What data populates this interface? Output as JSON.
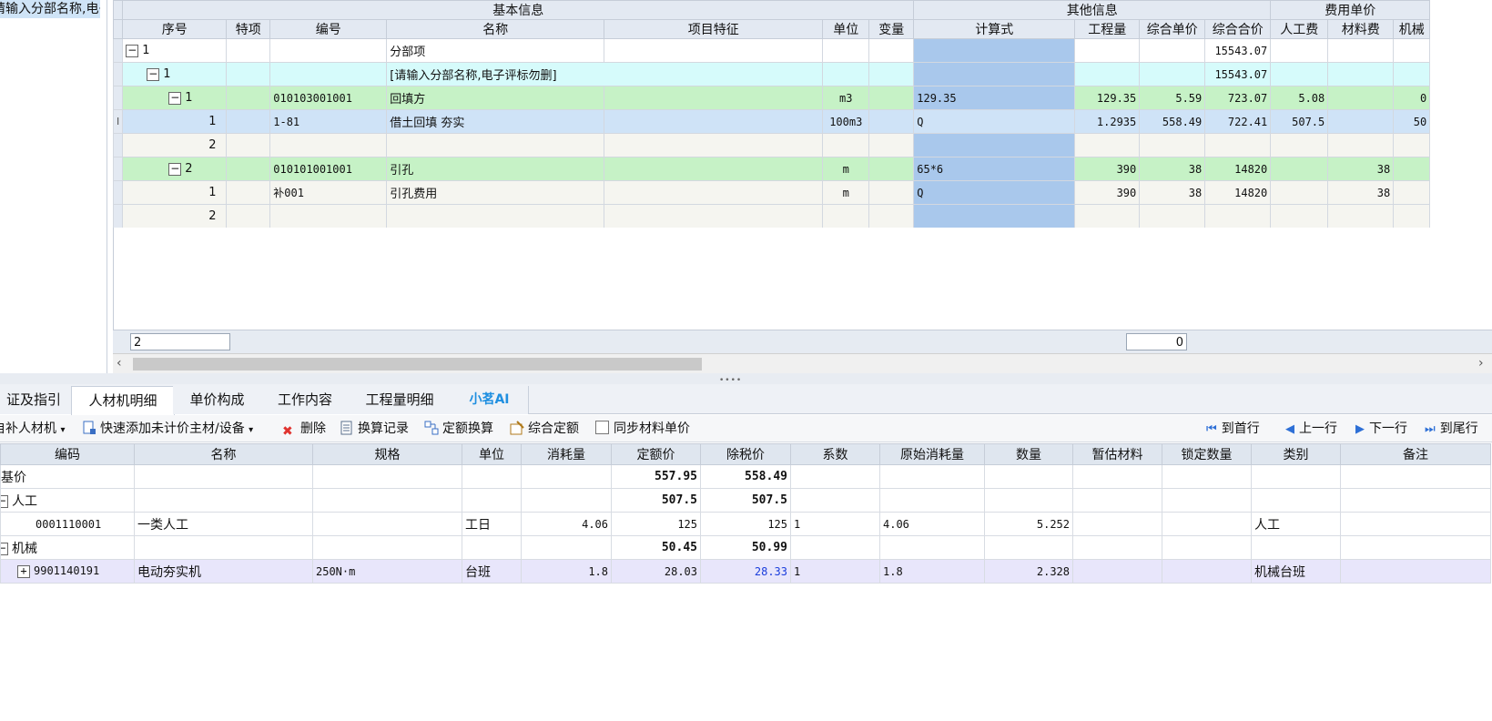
{
  "left_tree": {
    "selected_item": "请输入分部名称,电子评标勿删"
  },
  "top_grid": {
    "group_headers": {
      "basic": "基本信息",
      "other": "其他信息",
      "fee": "费用单价"
    },
    "columns": [
      "序号",
      "特项",
      "编号",
      "名称",
      "项目特征",
      "单位",
      "变量",
      "计算式",
      "工程量",
      "综合单价",
      "综合合价",
      "人工费",
      "材料费",
      "机械"
    ],
    "rows": [
      {
        "seq": "1",
        "code": "",
        "name": "分部项",
        "feature": "",
        "unit": "",
        "formula": "",
        "qty": "",
        "uprice": "",
        "total": "15543.07",
        "labor": "",
        "material": "",
        "machine": ""
      },
      {
        "seq": "1",
        "code": "",
        "name": "[请输入分部名称,电子评标勿删]",
        "feature": "",
        "unit": "",
        "formula": "",
        "qty": "",
        "uprice": "",
        "total": "15543.07",
        "labor": "",
        "material": "",
        "machine": ""
      },
      {
        "seq": "1",
        "code": "010103001001",
        "name": "回填方",
        "feature": "",
        "unit": "m3",
        "formula": "129.35",
        "qty": "129.35",
        "uprice": "5.59",
        "total": "723.07",
        "labor": "5.08",
        "material": "",
        "machine": "0"
      },
      {
        "seq": "1",
        "code": "1-81",
        "name": "借土回填 夯实",
        "feature": "",
        "unit": "100m3",
        "formula": "Q",
        "qty": "1.2935",
        "uprice": "558.49",
        "total": "722.41",
        "labor": "507.5",
        "material": "",
        "machine": "50"
      },
      {
        "seq": "2",
        "code": "",
        "name": "",
        "feature": "",
        "unit": "",
        "formula": "",
        "qty": "",
        "uprice": "",
        "total": "",
        "labor": "",
        "material": "",
        "machine": ""
      },
      {
        "seq": "2",
        "code": "010101001001",
        "name": "引孔",
        "feature": "",
        "unit": "m",
        "formula": "65*6",
        "qty": "390",
        "uprice": "38",
        "total": "14820",
        "labor": "",
        "material": "38",
        "machine": ""
      },
      {
        "seq": "1",
        "code": "补001",
        "name": "引孔费用",
        "feature": "",
        "unit": "m",
        "formula": "Q",
        "qty": "390",
        "uprice": "38",
        "total": "14820",
        "labor": "",
        "material": "38",
        "machine": ""
      },
      {
        "seq": "2",
        "code": "",
        "name": "",
        "feature": "",
        "unit": "",
        "formula": "",
        "qty": "",
        "uprice": "",
        "total": "",
        "labor": "",
        "material": "",
        "machine": ""
      }
    ],
    "footer": {
      "seq_input": "2",
      "qty_input": "0"
    }
  },
  "tabs": [
    {
      "label": "证及指引"
    },
    {
      "label": "人材机明细"
    },
    {
      "label": "单价构成"
    },
    {
      "label": "工作内容"
    },
    {
      "label": "工程量明细"
    },
    {
      "label": "小茗AI"
    }
  ],
  "toolbar": {
    "supplement": "自补人材机",
    "quick_add": "快速添加未计价主材/设备",
    "delete": "删除",
    "calc_record": "换算记录",
    "quota_convert": "定额换算",
    "composite_quota": "综合定额",
    "sync_price": "同步材料单价",
    "first": "到首行",
    "prev": "上一行",
    "next": "下一行",
    "last": "到尾行"
  },
  "bottom_grid": {
    "columns": [
      "编码",
      "名称",
      "规格",
      "单位",
      "消耗量",
      "定额价",
      "除税价",
      "系数",
      "原始消耗量",
      "数量",
      "暂估材料",
      "锁定数量",
      "类别",
      "备注"
    ],
    "rows": [
      {
        "code": "基价",
        "name": "",
        "spec": "",
        "unit": "",
        "consume": "",
        "quota": "557.95",
        "taxfree": "558.49",
        "coef": "",
        "orig": "",
        "qty": "",
        "category": ""
      },
      {
        "code": "人工",
        "name": "",
        "spec": "",
        "unit": "",
        "consume": "",
        "quota": "507.5",
        "taxfree": "507.5",
        "coef": "",
        "orig": "",
        "qty": "",
        "category": ""
      },
      {
        "code": "0001110001",
        "name": "一类人工",
        "spec": "",
        "unit": "工日",
        "consume": "4.06",
        "quota": "125",
        "taxfree": "125",
        "coef": "1",
        "orig": "4.06",
        "qty": "5.252",
        "category": "人工"
      },
      {
        "code": "机械",
        "name": "",
        "spec": "",
        "unit": "",
        "consume": "",
        "quota": "50.45",
        "taxfree": "50.99",
        "coef": "",
        "orig": "",
        "qty": "",
        "category": ""
      },
      {
        "code": "9901140191",
        "name": "电动夯实机",
        "spec": "250N·m",
        "unit": "台班",
        "consume": "1.8",
        "quota": "28.03",
        "taxfree": "28.33",
        "coef": "1",
        "orig": "1.8",
        "qty": "2.328",
        "category": "机械台班"
      }
    ]
  }
}
